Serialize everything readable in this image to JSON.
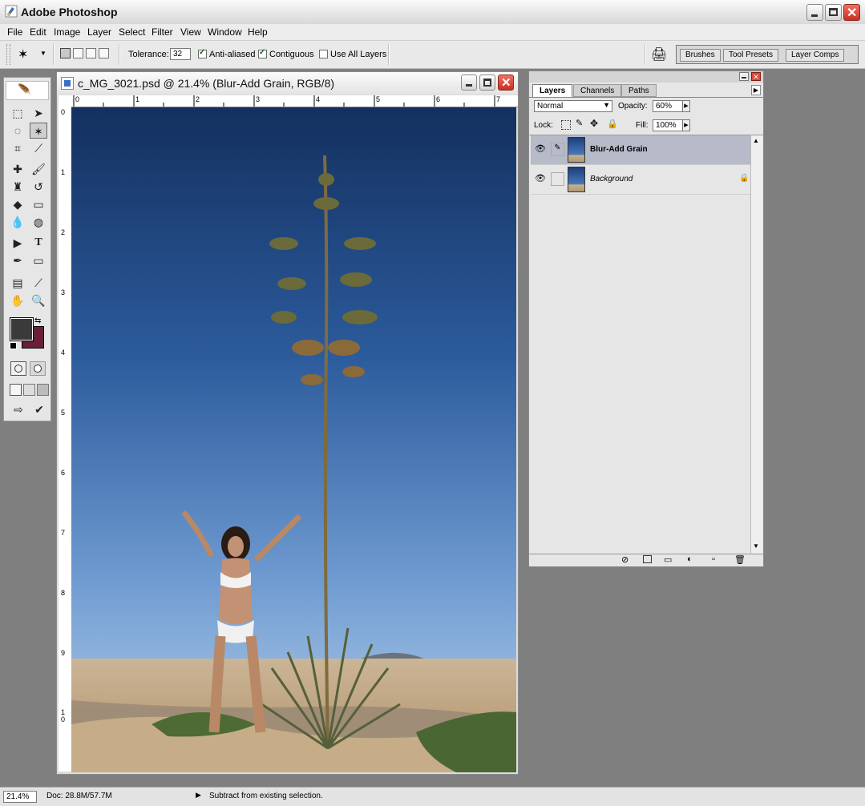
{
  "app": {
    "title": "Adobe Photoshop"
  },
  "menu": [
    "File",
    "Edit",
    "Image",
    "Layer",
    "Select",
    "Filter",
    "View",
    "Window",
    "Help"
  ],
  "options": {
    "tolerance_label": "Tolerance:",
    "tolerance_value": "32",
    "anti_aliased_label": "Anti-aliased",
    "anti_aliased": true,
    "contiguous_label": "Contiguous",
    "contiguous": true,
    "use_all_layers_label": "Use All Layers",
    "use_all_layers": false
  },
  "palette_well": [
    "Brushes",
    "Tool Presets",
    "Layer Comps"
  ],
  "document": {
    "title": "c_MG_3021.psd @ 21.4% (Blur-Add Grain, RGB/8)",
    "ruler_top": [
      "0",
      "1",
      "2",
      "3",
      "4",
      "5",
      "6",
      "7"
    ],
    "ruler_left": [
      "0",
      "1",
      "2",
      "3",
      "4",
      "5",
      "6",
      "7",
      "8",
      "9",
      "1\n0"
    ]
  },
  "layers_panel": {
    "tabs": [
      "Layers",
      "Channels",
      "Paths"
    ],
    "blend_mode": "Normal",
    "opacity_label": "Opacity:",
    "opacity_value": "60%",
    "lock_label": "Lock:",
    "fill_label": "Fill:",
    "fill_value": "100%",
    "layers": [
      {
        "name": "Blur-Add Grain",
        "selected": true
      },
      {
        "name": "Background",
        "selected": false,
        "locked": true
      }
    ]
  },
  "colors": {
    "foreground": "#3a3a3a",
    "background": "#6b1f36"
  },
  "status": {
    "zoom": "21.4%",
    "doc": "Doc: 28.8M/57.7M",
    "message": "Subtract from existing selection."
  }
}
